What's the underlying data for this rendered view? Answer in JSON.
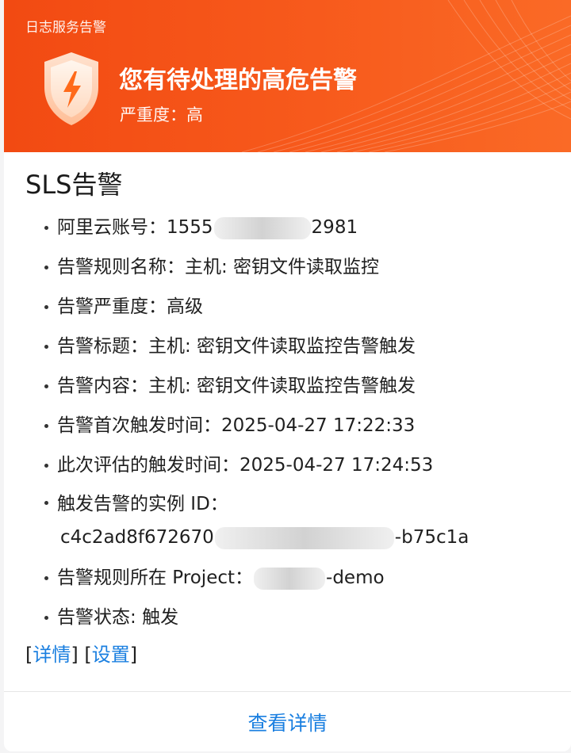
{
  "banner": {
    "app_name": "日志服务告警",
    "title": "您有待处理的高危告警",
    "severity": "严重度：高"
  },
  "content": {
    "heading": "SLS告警",
    "fields": [
      {
        "label": "阿里云账号：",
        "value_prefix": "1555",
        "value_suffix": "2981"
      },
      {
        "label": "告警规则名称：",
        "value": "主机: 密钥文件读取监控"
      },
      {
        "label": "告警严重度：",
        "value": "高级"
      },
      {
        "label": "告警标题：",
        "value": "主机: 密钥文件读取监控告警触发"
      },
      {
        "label": "告警内容：",
        "value": "主机: 密钥文件读取监控告警触发"
      },
      {
        "label": "告警首次触发时间：",
        "value": "2025-04-27 17:22:33"
      },
      {
        "label": "此次评估的触发时间：",
        "value": "2025-04-27 17:24:53"
      },
      {
        "label": "触发告警的实例 ID：",
        "value_prefix": "c4c2ad8f672670",
        "value_suffix": "-b75c1a"
      },
      {
        "label": "告警规则所在 Project：",
        "value_suffix": "-demo"
      },
      {
        "label": "告警状态: ",
        "value": "触发"
      }
    ],
    "links": {
      "open": "[",
      "close": "]",
      "details": "详情",
      "settings": "设置"
    }
  },
  "footer": {
    "button_label": "查看详情"
  },
  "colors": {
    "banner": "#f24a12",
    "link": "#1a7fe0"
  },
  "icons": {
    "badge": "shield-lightning-icon"
  }
}
